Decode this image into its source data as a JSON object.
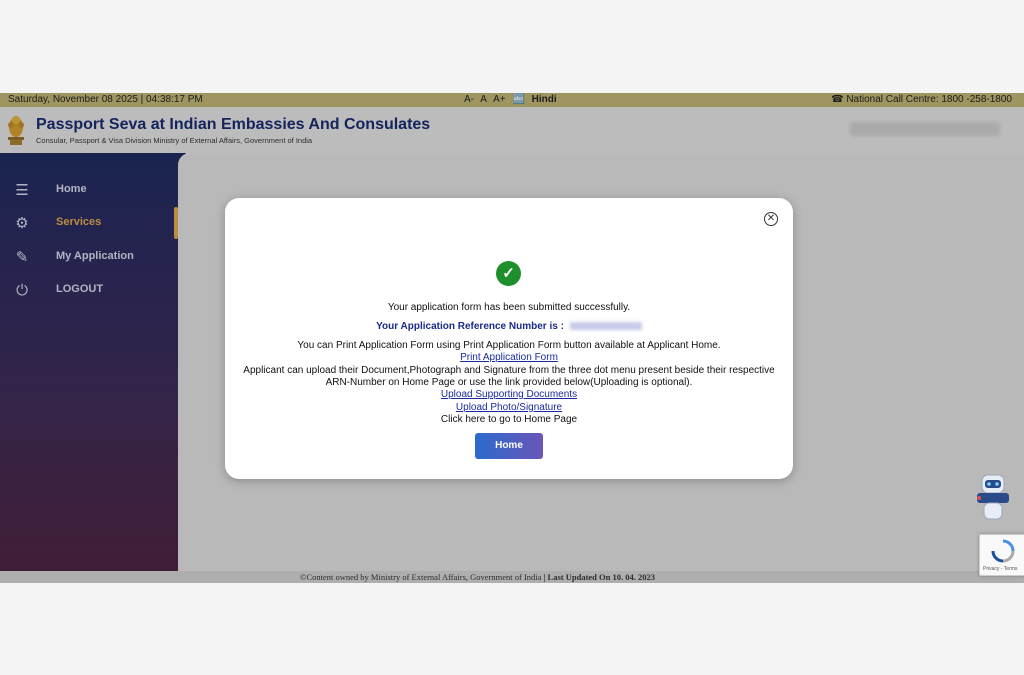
{
  "topbar": {
    "datetime": "Saturday, November 08 2025 | 04:38:17 PM",
    "font_small": "A-",
    "font_normal": "A",
    "font_large": "A+",
    "language": "Hindi",
    "call_centre": "National Call Centre: 1800 -258-1800"
  },
  "header": {
    "title": "Passport Seva at Indian Embassies And Consulates",
    "subtitle": "Consular, Passport & Visa Division Ministry of External Affairs, Government of India"
  },
  "sidebar": {
    "items": [
      {
        "label": "Home",
        "icon": "search-menu-icon"
      },
      {
        "label": "Services",
        "icon": "services-icon",
        "active": true
      },
      {
        "label": "My Application",
        "icon": "application-icon"
      },
      {
        "label": "LOGOUT",
        "icon": "logout-icon"
      }
    ]
  },
  "modal": {
    "success_message": "Your application form has been submitted successfully.",
    "reference_label": "Your Application Reference Number is :",
    "print_info": "You can Print Application Form using Print Application Form button available at Applicant Home.",
    "print_link": "Print Application Form",
    "upload_info_1": "Applicant can upload their Document,Photograph and Signature from the three dot menu present beside their respective",
    "upload_info_2": "ARN-Number on Home Page or use the link provided below(Uploading is optional).",
    "upload_docs_link": "Upload Supporting Documents",
    "upload_photo_link": "Upload Photo/Signature",
    "home_info": "Click here to go to Home Page",
    "home_button": "Home"
  },
  "footer": {
    "content": "©Content owned by Ministry of External Affairs, Government of India",
    "updated": "| Last Updated On 10. 04. 2023"
  },
  "recaptcha": {
    "text": "Privacy - Terms"
  },
  "colors": {
    "topbar": "#b6aa6e",
    "title": "#1a2a6c",
    "active_nav": "#d7a04a",
    "success": "#1e8f2a",
    "button_start": "#2b6bcc",
    "button_end": "#6a55b8"
  }
}
